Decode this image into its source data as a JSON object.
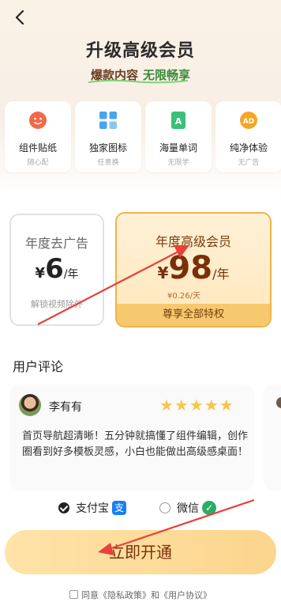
{
  "header": {
    "title": "升级高级会员",
    "subtitle_part1": "爆款内容",
    "subtitle_part2": "无限畅享"
  },
  "features": [
    {
      "title": "组件贴纸",
      "sub": "随心配",
      "icon": "sticker-icon"
    },
    {
      "title": "独家图标",
      "sub": "任意换",
      "icon": "grid-icon"
    },
    {
      "title": "海量单词",
      "sub": "无限学",
      "icon": "word-book-icon"
    },
    {
      "title": "纯净体验",
      "sub": "无广告",
      "icon": "ad-free-icon"
    }
  ],
  "plans": {
    "basic": {
      "name": "年度去广告",
      "currency": "¥",
      "price": "6",
      "period": "/年",
      "desc": "解锁视频除外"
    },
    "premium": {
      "name": "年度高级会员",
      "currency": "¥",
      "price": "98",
      "period": "/年",
      "daily": "¥0.26/天",
      "footer": "尊享全部特权",
      "selected": true
    }
  },
  "reviews": {
    "section_title": "用户评论",
    "items": [
      {
        "user": "李有有",
        "stars": "★★★★★",
        "text": "首页导航超清晰！五分钟就搞懂了组件编辑，创作圈看到好多模板灵感，小白也能做出高级感桌面！"
      }
    ]
  },
  "payment": {
    "alipay": {
      "label": "支付宝",
      "icon_text": "支",
      "selected": true
    },
    "wechat": {
      "label": "微信",
      "icon_text": "✓",
      "selected": false
    }
  },
  "cta_label": "立即开通",
  "agreement": {
    "prefix": "同意",
    "privacy": "《隐私政策》",
    "and": "和",
    "terms": "《用户协议》"
  },
  "colors": {
    "accent": "#f0b24a",
    "cta": "#fcd58e",
    "price": "#7a2f08",
    "annotation_arrow": "#e8413a"
  }
}
